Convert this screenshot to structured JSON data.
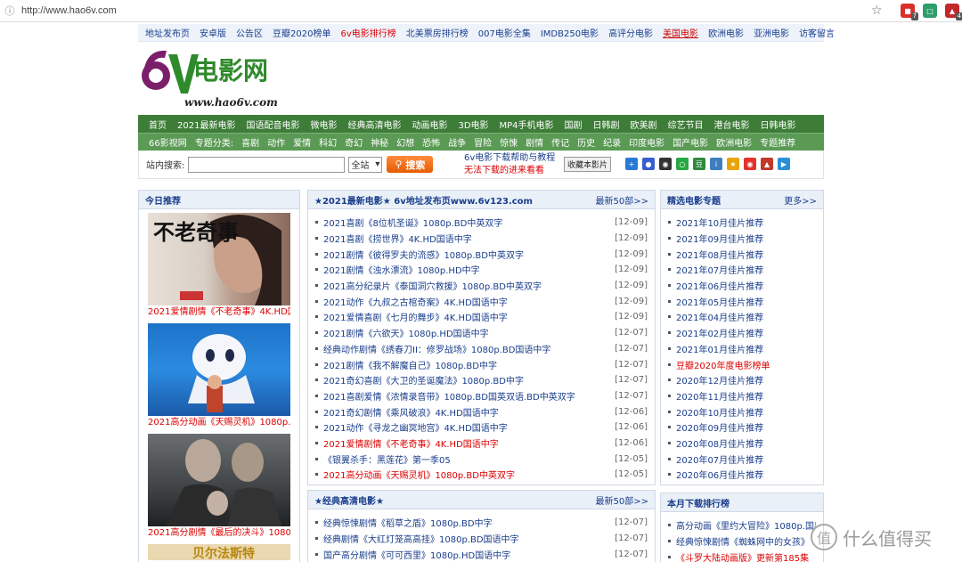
{
  "browser": {
    "url": "http://www.hao6v.com",
    "ext_badge_1": "7",
    "ext_badge_2": "4"
  },
  "topnav": [
    {
      "label": "地址发布页",
      "style": ""
    },
    {
      "label": "安卓版",
      "style": ""
    },
    {
      "label": "公告区",
      "style": ""
    },
    {
      "label": "豆瓣2020榜单",
      "style": ""
    },
    {
      "label": "6v电影排行榜",
      "style": "red"
    },
    {
      "label": "北美票房排行榜",
      "style": ""
    },
    {
      "label": "007电影全集",
      "style": ""
    },
    {
      "label": "IMDB250电影",
      "style": ""
    },
    {
      "label": "高评分电影",
      "style": ""
    },
    {
      "label": "美国电影",
      "style": "underline"
    },
    {
      "label": "欧洲电影",
      "style": ""
    },
    {
      "label": "亚洲电影",
      "style": ""
    },
    {
      "label": "访客留言",
      "style": ""
    }
  ],
  "logo": {
    "glyph": "6v",
    "title": "电影网",
    "url": "www.hao6v.com"
  },
  "mainnav": [
    "首页",
    "2021最新电影",
    "国语配音电影",
    "微电影",
    "经典高清电影",
    "动画电影",
    "3D电影",
    "MP4手机电影",
    "国剧",
    "日韩剧",
    "欧美剧",
    "综艺节目",
    "港台电影",
    "日韩电影"
  ],
  "subnav": {
    "first": "66影视网",
    "label": "专题分类:",
    "items": [
      "喜剧",
      "动作",
      "爱情",
      "科幻",
      "奇幻",
      "神秘",
      "幻想",
      "恐怖",
      "战争",
      "冒险",
      "惊悚",
      "剧情",
      "传记",
      "历史",
      "纪录",
      "印度电影",
      "国产电影",
      "欧洲电影",
      "专题推荐"
    ]
  },
  "search": {
    "label": "站内搜索:",
    "value": "",
    "scope": "全站",
    "button": "搜索",
    "help": "6v电影下载帮助与教程",
    "cant_download": "无法下载的进来看看",
    "favorite": "收藏本影片"
  },
  "left": {
    "title": "今日推荐",
    "posters": [
      {
        "caption": "2021爱情剧情《不老奇事》4K.HD国",
        "art": "不老奇事"
      },
      {
        "caption": "2021高分动画《天赐灵机》1080p.B",
        "art": ""
      },
      {
        "caption": "2021高分剧情《最后的决斗》1080p",
        "art": ""
      },
      {
        "caption": "",
        "art": "贝尔法斯特"
      }
    ]
  },
  "middle": {
    "title": "★2021最新电影★ 6v地址发布页www.6v123.com",
    "more": "最新50部>>",
    "items": [
      {
        "text": "2021喜剧《8位机圣诞》1080p.BD中英双字",
        "date": "[12-09]",
        "red": false
      },
      {
        "text": "2021喜剧《捞世界》4K.HD国语中字",
        "date": "[12-09]",
        "red": false
      },
      {
        "text": "2021剧情《彼得罗夫的流感》1080p.BD中英双字",
        "date": "[12-09]",
        "red": false
      },
      {
        "text": "2021剧情《浊水漂流》1080p.HD中字",
        "date": "[12-09]",
        "red": false
      },
      {
        "text": "2021高分纪录片《泰国洞穴救援》1080p.BD中英双字",
        "date": "[12-09]",
        "red": false
      },
      {
        "text": "2021动作《九叔之古棺奇案》4K.HD国语中字",
        "date": "[12-09]",
        "red": false
      },
      {
        "text": "2021爱情喜剧《七月的舞步》4K.HD国语中字",
        "date": "[12-09]",
        "red": false
      },
      {
        "text": "2021剧情《六欲天》1080p.HD国语中字",
        "date": "[12-07]",
        "red": false
      },
      {
        "text": "经典动作剧情《绣春刀II：修罗战场》1080p.BD国语中字",
        "date": "[12-07]",
        "red": false
      },
      {
        "text": "2021剧情《我不解魔自己》1080p.BD中字",
        "date": "[12-07]",
        "red": false
      },
      {
        "text": "2021奇幻喜剧《大卫的圣诞魔法》1080p.BD中字",
        "date": "[12-07]",
        "red": false
      },
      {
        "text": "2021喜剧爱情《浓情录音带》1080p.BD国英双语.BD中英双字",
        "date": "[12-07]",
        "red": false
      },
      {
        "text": "2021奇幻剧情《乘风破浪》4K.HD国语中字",
        "date": "[12-06]",
        "red": false
      },
      {
        "text": "2021动作《寻龙之幽冥地宫》4K.HD国语中字",
        "date": "[12-06]",
        "red": false
      },
      {
        "text": "2021爱情剧情《不老奇事》4K.HD国语中字",
        "date": "[12-06]",
        "red": true
      },
      {
        "text": "《银翼杀手：黑莲花》第一季05",
        "date": "[12-05]",
        "red": false
      },
      {
        "text": "2021高分动画《天赐灵机》1080p.BD中英双字",
        "date": "[12-05]",
        "red": true
      }
    ]
  },
  "middle2": {
    "title": "★经典高清电影★",
    "more": "最新50部>>",
    "items": [
      {
        "text": "经典惊悚剧情《稻草之盾》1080p.BD中字",
        "date": "[12-07]",
        "red": false
      },
      {
        "text": "经典剧情《大红灯笼高高挂》1080p.BD国语中字",
        "date": "[12-07]",
        "red": false
      },
      {
        "text": "国产高分剧情《可可西里》1080p.HD国语中字",
        "date": "[12-07]",
        "red": false
      }
    ]
  },
  "right": {
    "title": "精选电影专题",
    "more": "更多>>",
    "items": [
      {
        "text": "2021年10月佳片推荐",
        "red": false
      },
      {
        "text": "2021年09月佳片推荐",
        "red": false
      },
      {
        "text": "2021年08月佳片推荐",
        "red": false
      },
      {
        "text": "2021年07月佳片推荐",
        "red": false
      },
      {
        "text": "2021年06月佳片推荐",
        "red": false
      },
      {
        "text": "2021年05月佳片推荐",
        "red": false
      },
      {
        "text": "2021年04月佳片推荐",
        "red": false
      },
      {
        "text": "2021年02月佳片推荐",
        "red": false
      },
      {
        "text": "2021年01月佳片推荐",
        "red": false
      },
      {
        "text": "豆瓣2020年度电影榜单",
        "red": true
      },
      {
        "text": "2020年12月佳片推荐",
        "red": false
      },
      {
        "text": "2020年11月佳片推荐",
        "red": false
      },
      {
        "text": "2020年10月佳片推荐",
        "red": false
      },
      {
        "text": "2020年09月佳片推荐",
        "red": false
      },
      {
        "text": "2020年08月佳片推荐",
        "red": false
      },
      {
        "text": "2020年07月佳片推荐",
        "red": false
      },
      {
        "text": "2020年06月佳片推荐",
        "red": false
      }
    ]
  },
  "right2": {
    "title": "本月下载排行榜",
    "items": [
      {
        "text": "高分动画《里约大冒险》1080p.国粤",
        "red": false
      },
      {
        "text": "经典惊悚剧情《蜘蛛网中的女孩》",
        "red": false
      },
      {
        "text": "《斗罗大陆动画版》更新第185集",
        "red": true
      }
    ]
  },
  "watermark": {
    "text": "什么值得买",
    "glyph": "值"
  }
}
